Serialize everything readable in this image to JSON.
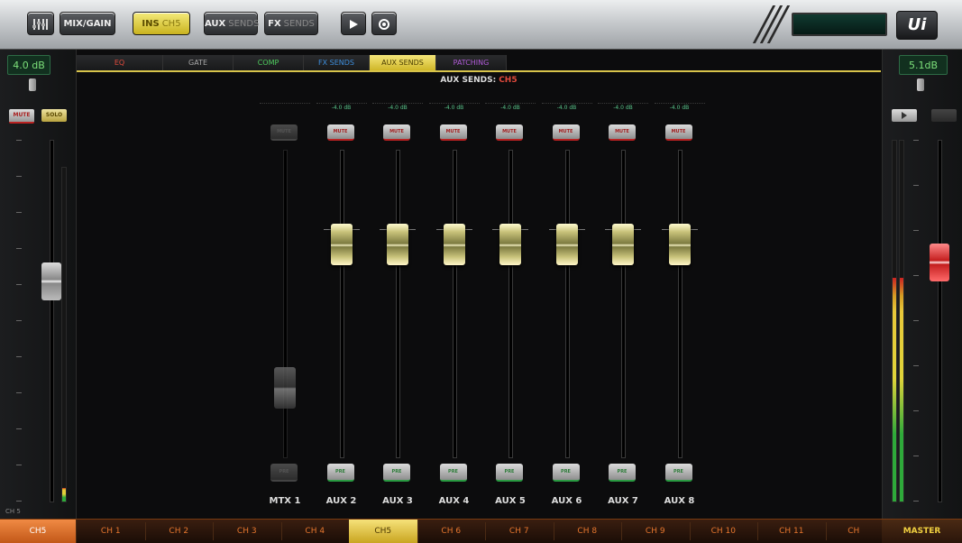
{
  "toolbar": {
    "home_icon": "mixer-grid-icon",
    "mix_gain_label": "MIX/GAIN",
    "ch5_label": "INS",
    "ch5_sub": "CH5",
    "aux_label": "AUX",
    "aux_sub": "SENDS",
    "fx_label": "FX",
    "fx_sub": "SENDS",
    "play_icon": "play-icon",
    "record_icon": "record-icon",
    "display_text": "Ui",
    "logo": "Ui"
  },
  "left_strip": {
    "gain": "4.0 dB",
    "mute_label": "MUTE",
    "solo_label": "SOLO",
    "bottom_label": "CH 5",
    "fader_level": 0.62
  },
  "right_strip": {
    "gain": "5.1dB",
    "play_icon": "play-icon",
    "fader_level": 0.68,
    "meter_level": 0.62
  },
  "tabs": [
    {
      "label": "EQ",
      "color": "#e24a3c"
    },
    {
      "label": "GATE",
      "color": "#a8a8a8"
    },
    {
      "label": "COMP",
      "color": "#4ecb5e"
    },
    {
      "label": "FX SENDS",
      "color": "#3d8ddb"
    },
    {
      "label": "AUX SENDS",
      "color": "#4a3d00"
    },
    {
      "label": "PATCHING",
      "color": "#b05ad8"
    }
  ],
  "panel": {
    "title": "AUX SENDS:",
    "channel": "CH5"
  },
  "aux_sends": [
    {
      "name": "MTX 1",
      "value": "",
      "mute": "MUTE",
      "pre": "PRE",
      "level": 0.18,
      "disabled": true
    },
    {
      "name": "AUX 2",
      "value": "-4.0 dB",
      "mute": "MUTE",
      "pre": "PRE",
      "level": 0.72,
      "disabled": false
    },
    {
      "name": "AUX 3",
      "value": "-4.0 dB",
      "mute": "MUTE",
      "pre": "PRE",
      "level": 0.72,
      "disabled": false
    },
    {
      "name": "AUX 4",
      "value": "-4.0 dB",
      "mute": "MUTE",
      "pre": "PRE",
      "level": 0.72,
      "disabled": false
    },
    {
      "name": "AUX 5",
      "value": "-4.0 dB",
      "mute": "MUTE",
      "pre": "PRE",
      "level": 0.72,
      "disabled": false
    },
    {
      "name": "AUX 6",
      "value": "-4.0 dB",
      "mute": "MUTE",
      "pre": "PRE",
      "level": 0.72,
      "disabled": false
    },
    {
      "name": "AUX 7",
      "value": "-4.0 dB",
      "mute": "MUTE",
      "pre": "PRE",
      "level": 0.72,
      "disabled": false
    },
    {
      "name": "AUX 8",
      "value": "-4.0 dB",
      "mute": "MUTE",
      "pre": "PRE",
      "level": 0.72,
      "disabled": false
    }
  ],
  "channels": {
    "current": "CH5",
    "list": [
      "CH 1",
      "CH 2",
      "CH 3",
      "CH 4",
      "CH5",
      "CH 6",
      "CH 7",
      "CH 8",
      "CH 9",
      "CH 10",
      "CH 11",
      "CH"
    ],
    "active_index": 4,
    "master": "MASTER"
  }
}
